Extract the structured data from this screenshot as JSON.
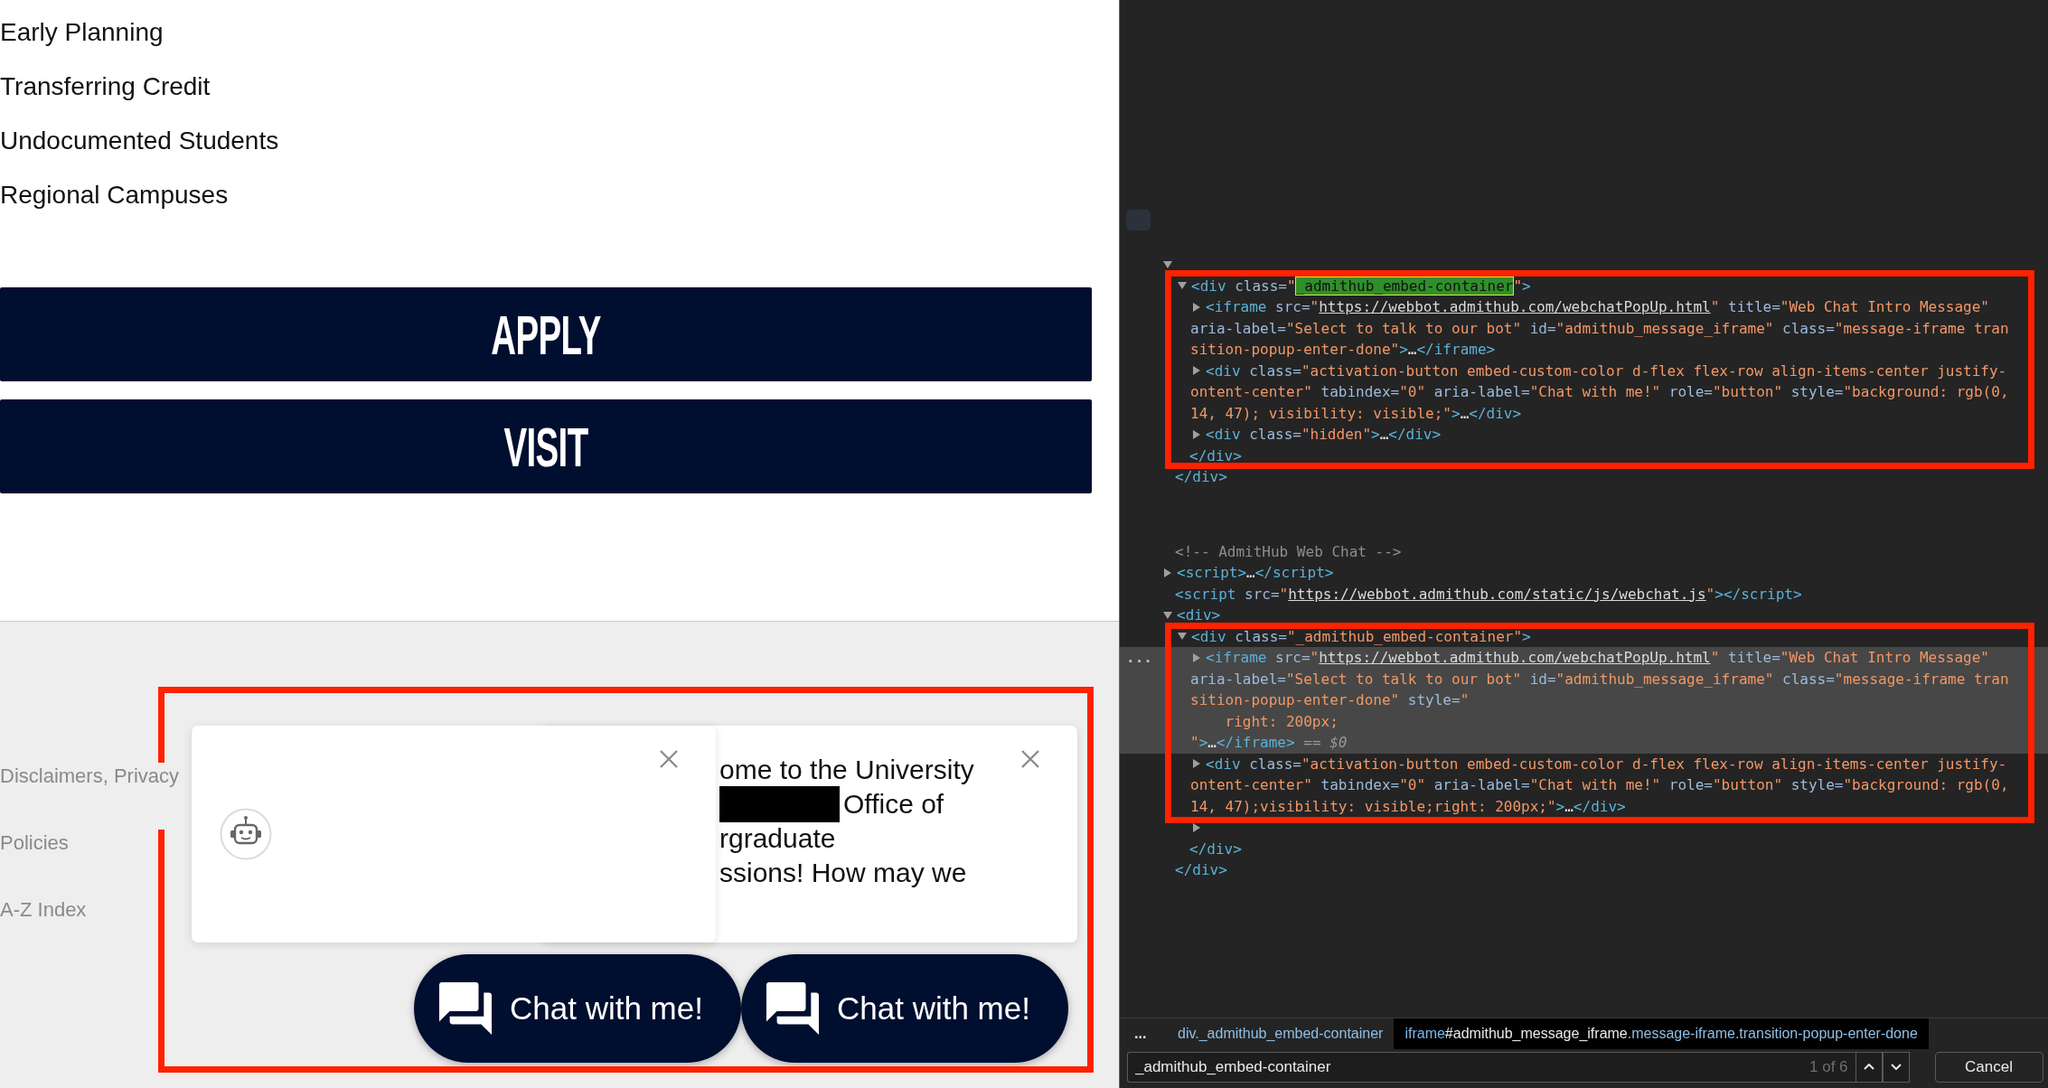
{
  "page": {
    "links": [
      {
        "label": "Early Planning"
      },
      {
        "label": "Transferring Credit"
      },
      {
        "label": "Undocumented Students"
      },
      {
        "label": "Regional Campuses"
      }
    ],
    "actions": [
      {
        "label": "APPLY"
      },
      {
        "label": "VISIT"
      }
    ],
    "footer_links": [
      {
        "label": "Disclaimers, Privacy"
      },
      {
        "label": "Policies"
      },
      {
        "label": "A-Z Index"
      }
    ]
  },
  "chat_widget": {
    "popups": [
      {
        "kind": "message",
        "lines": [
          {
            "redacted": false,
            "text": "ome to the University"
          },
          {
            "redacted": true,
            "text": "Office of"
          },
          {
            "redacted": false,
            "text": "rgraduate"
          },
          {
            "redacted": false,
            "text": "ssions! How may we"
          }
        ]
      },
      {
        "kind": "avatar"
      }
    ],
    "chat_buttons": [
      {
        "label": "Chat with me!"
      },
      {
        "label": "Chat with me!"
      }
    ]
  },
  "devtools": {
    "elements": [
      {
        "selected": false,
        "expanded": true,
        "children": [
          {
            "selected": false,
            "expanded": true,
            "lines": [
              [
                {
                  "kind": "tag",
                  "text": "<div "
                },
                {
                  "kind": "attr",
                  "text": "class="
                },
                {
                  "kind": "value",
                  "text": "\""
                },
                {
                  "kind": "match",
                  "text": "_admithub_embed-container"
                },
                {
                  "kind": "value",
                  "text": "\""
                },
                {
                  "kind": "tag",
                  "text": ">"
                }
              ]
            ],
            "children": [
              {
                "selected": false,
                "expanded": false,
                "lines": [
                  [
                    {
                      "kind": "tag",
                      "text": "<iframe "
                    },
                    {
                      "kind": "attr",
                      "text": "src="
                    },
                    {
                      "kind": "value",
                      "text": "\""
                    },
                    {
                      "kind": "link",
                      "text": "https://webbot.admithub.com/webchatPopUp.html"
                    },
                    {
                      "kind": "value",
                      "text": "\""
                    },
                    {
                      "kind": "attr",
                      "text": " title="
                    },
                    {
                      "kind": "value",
                      "text": "\"Web Chat Intro Message\""
                    }
                  ],
                  [
                    {
                      "kind": "attr",
                      "text": "aria-label="
                    },
                    {
                      "kind": "value",
                      "text": "\"Select to talk to our bot\""
                    },
                    {
                      "kind": "attr",
                      "text": " id="
                    },
                    {
                      "kind": "value",
                      "text": "\"admithub_message_iframe\""
                    },
                    {
                      "kind": "attr",
                      "text": " class="
                    },
                    {
                      "kind": "value",
                      "text": "\"message-iframe tran"
                    }
                  ],
                  [
                    {
                      "kind": "value",
                      "text": "sition-popup-enter-done\""
                    },
                    {
                      "kind": "tag",
                      "text": ">"
                    },
                    {
                      "kind": "text",
                      "text": "…"
                    },
                    {
                      "kind": "tag",
                      "text": "</iframe>"
                    }
                  ]
                ]
              },
              {
                "selected": false,
                "expanded": false,
                "lines": [
                  [
                    {
                      "kind": "tag",
                      "text": "<div "
                    },
                    {
                      "kind": "attr",
                      "text": "class="
                    },
                    {
                      "kind": "value",
                      "text": "\"activation-button embed-custom-color d-flex flex-row align-items-center justify-"
                    }
                  ],
                  [
                    {
                      "kind": "value",
                      "text": "ontent-center\""
                    },
                    {
                      "kind": "attr",
                      "text": " tabindex="
                    },
                    {
                      "kind": "value",
                      "text": "\"0\""
                    },
                    {
                      "kind": "attr",
                      "text": " aria-label="
                    },
                    {
                      "kind": "value",
                      "text": "\"Chat with me!\""
                    },
                    {
                      "kind": "attr",
                      "text": " role="
                    },
                    {
                      "kind": "value",
                      "text": "\"button\""
                    },
                    {
                      "kind": "attr",
                      "text": " style="
                    },
                    {
                      "kind": "value",
                      "text": "\"background: rgb(0,"
                    }
                  ],
                  [
                    {
                      "kind": "value",
                      "text": "14, 47); visibility: visible;\""
                    },
                    {
                      "kind": "tag",
                      "text": ">"
                    },
                    {
                      "kind": "text",
                      "text": "…"
                    },
                    {
                      "kind": "tag",
                      "text": "</div>"
                    }
                  ]
                ]
              },
              {
                "selected": false,
                "expanded": false,
                "lines": [
                  [
                    {
                      "kind": "tag",
                      "text": "<div "
                    },
                    {
                      "kind": "attr",
                      "text": "class="
                    },
                    {
                      "kind": "value",
                      "text": "\"hidden\""
                    },
                    {
                      "kind": "tag",
                      "text": ">"
                    },
                    {
                      "kind": "text",
                      "text": "…"
                    },
                    {
                      "kind": "tag",
                      "text": "</div>"
                    }
                  ]
                ]
              }
            ],
            "closing": [
              {
                "kind": "tag",
                "text": "</div>"
              }
            ]
          }
        ],
        "closing": [
          {
            "kind": "tag",
            "text": "</div>"
          }
        ]
      },
      {
        "selected": false,
        "kind": "comment",
        "lines": [
          [
            {
              "kind": "comment",
              "text": "<!-- AdmitHub Web Chat -->"
            }
          ]
        ]
      },
      {
        "selected": false,
        "expanded": false,
        "lines": [
          [
            {
              "kind": "tag",
              "text": "<script>"
            },
            {
              "kind": "text",
              "text": "…"
            },
            {
              "kind": "tag",
              "text": "</script>"
            }
          ]
        ]
      },
      {
        "selected": false,
        "lines": [
          [
            {
              "kind": "tag",
              "text": "<script "
            },
            {
              "kind": "attr",
              "text": "src="
            },
            {
              "kind": "value",
              "text": "\""
            },
            {
              "kind": "link",
              "text": "https://webbot.admithub.com/static/js/webchat.js"
            },
            {
              "kind": "value",
              "text": "\""
            },
            {
              "kind": "tag",
              "text": "></script>"
            }
          ]
        ]
      },
      {
        "selected": false,
        "expanded": true,
        "lines": [
          [
            {
              "kind": "tag",
              "text": "<div>"
            }
          ]
        ],
        "children": [
          {
            "selected": false,
            "expanded": true,
            "lines": [
              [
                {
                  "kind": "tag",
                  "text": "<div "
                },
                {
                  "kind": "attr",
                  "text": "class="
                },
                {
                  "kind": "value",
                  "text": "\"_admithub_embed-container\""
                },
                {
                  "kind": "tag",
                  "text": ">"
                }
              ]
            ],
            "children": [
              {
                "selected": true,
                "gutter": "...",
                "expanded": false,
                "lines": [
                  [
                    {
                      "kind": "tag",
                      "text": "<iframe "
                    },
                    {
                      "kind": "attr",
                      "text": "src="
                    },
                    {
                      "kind": "value",
                      "text": "\""
                    },
                    {
                      "kind": "link",
                      "text": "https://webbot.admithub.com/webchatPopUp.html"
                    },
                    {
                      "kind": "value",
                      "text": "\""
                    },
                    {
                      "kind": "attr",
                      "text": " title="
                    },
                    {
                      "kind": "value",
                      "text": "\"Web Chat Intro Message\""
                    }
                  ],
                  [
                    {
                      "kind": "attr",
                      "text": "aria-label="
                    },
                    {
                      "kind": "value",
                      "text": "\"Select to talk to our bot\""
                    },
                    {
                      "kind": "attr",
                      "text": " id="
                    },
                    {
                      "kind": "value",
                      "text": "\"admithub_message_iframe\""
                    },
                    {
                      "kind": "attr",
                      "text": " class="
                    },
                    {
                      "kind": "value",
                      "text": "\"message-iframe tran"
                    }
                  ],
                  [
                    {
                      "kind": "value",
                      "text": "sition-popup-enter-done\""
                    },
                    {
                      "kind": "attr",
                      "text": " style="
                    },
                    {
                      "kind": "value",
                      "text": "\""
                    }
                  ],
                  [
                    {
                      "kind": "value",
                      "text": "    right: 200px;"
                    }
                  ],
                  [
                    {
                      "kind": "value",
                      "text": "\""
                    },
                    {
                      "kind": "tag",
                      "text": ">"
                    },
                    {
                      "kind": "text",
                      "text": "…"
                    },
                    {
                      "kind": "tag",
                      "text": "</iframe>"
                    },
                    {
                      "kind": "dim",
                      "text": " == $0"
                    }
                  ]
                ]
              },
              {
                "selected": false,
                "expanded": false,
                "lines": [
                  [
                    {
                      "kind": "tag",
                      "text": "<div "
                    },
                    {
                      "kind": "attr",
                      "text": "class="
                    },
                    {
                      "kind": "value",
                      "text": "\"activation-button embed-custom-color d-flex flex-row align-items-center justify-"
                    }
                  ],
                  [
                    {
                      "kind": "value",
                      "text": "ontent-center\""
                    },
                    {
                      "kind": "attr",
                      "text": " tabindex="
                    },
                    {
                      "kind": "value",
                      "text": "\"0\""
                    },
                    {
                      "kind": "attr",
                      "text": " aria-label="
                    },
                    {
                      "kind": "value",
                      "text": "\"Chat with me!\""
                    },
                    {
                      "kind": "attr",
                      "text": " role="
                    },
                    {
                      "kind": "value",
                      "text": "\"button\""
                    },
                    {
                      "kind": "attr",
                      "text": " style="
                    },
                    {
                      "kind": "value",
                      "text": "\"background: rgb(0,"
                    }
                  ],
                  [
                    {
                      "kind": "value",
                      "text": "14, 47);visibility: visible;right: 200px;\""
                    },
                    {
                      "kind": "tag",
                      "text": ">"
                    },
                    {
                      "kind": "text",
                      "text": "…"
                    },
                    {
                      "kind": "tag",
                      "text": "</div>"
                    }
                  ]
                ]
              },
              {
                "selected": false,
                "expanded": false
              }
            ],
            "closing": [
              {
                "kind": "tag",
                "text": "</div>"
              }
            ]
          }
        ],
        "closing": [
          {
            "kind": "tag",
            "text": "</div>"
          }
        ]
      }
    ],
    "breadcrumbs": {
      "overflow": "...",
      "items": [
        {
          "selected": false,
          "parts": [
            {
              "kind": "cls",
              "text": "div._admithub_embed-container"
            }
          ]
        },
        {
          "selected": true,
          "parts": [
            {
              "kind": "tag",
              "text": "iframe"
            },
            {
              "kind": "id",
              "text": "#admithub_message_iframe"
            },
            {
              "kind": "cls",
              "text": ".message-iframe.transition-popup-enter-done"
            }
          ]
        }
      ]
    },
    "search": {
      "value": "_admithub_embed-container",
      "count": "1 of 6",
      "cancel": "Cancel"
    }
  }
}
